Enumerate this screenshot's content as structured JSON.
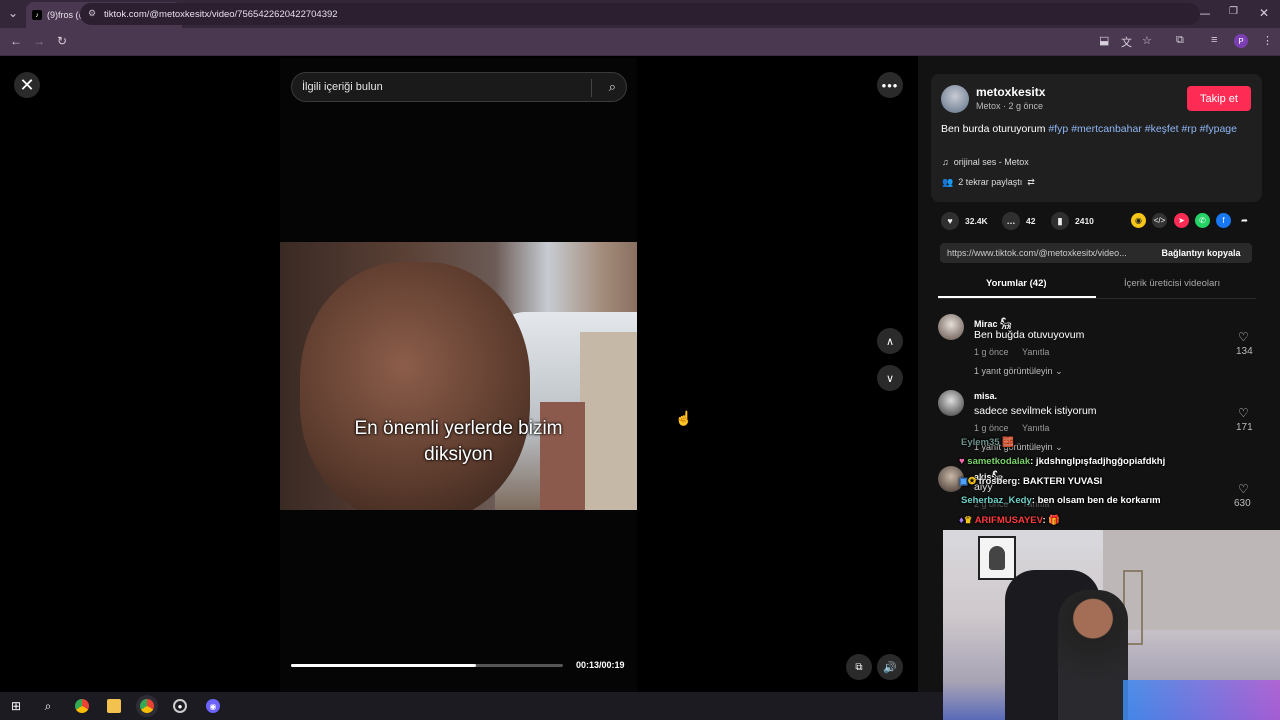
{
  "browser": {
    "tab_title": "(9)fros (@frosberg) | TikTok",
    "url": "tiktok.com/@metoxkesitx/video/7565422620422704392",
    "profile_initial": "P"
  },
  "video": {
    "search_placeholder": "İlgili içeriği bulun",
    "caption_line1": "En önemli yerlerde bizim",
    "caption_line2": "diksiyon",
    "time": "00:13/00:19",
    "progress": 0.68
  },
  "post": {
    "username": "metoxkesitx",
    "sub": "Metox · 2 g önce",
    "follow_label": "Takip et",
    "desc_text": "Ben burda oturuyorum",
    "hashtags": [
      "#fyp",
      "#mertcanbahar",
      "#keşfet",
      "#rp",
      "#fypage"
    ],
    "music": "orijinal ses - Metox",
    "reposts": "2 tekrar paylaştı",
    "likes": "32.4K",
    "comments": "42",
    "saves": "2410",
    "link": "https://www.tiktok.com/@metoxkesitx/video...",
    "copy_label": "Bağlantıyı kopyala"
  },
  "tabs": {
    "comments": "Yorumlar (42)",
    "creator": "İçerik üreticisi videoları"
  },
  "comments": [
    {
      "name": "Mirac 𓃵",
      "text": "Ben buğda otuvuyovum",
      "time": "1 g önce",
      "reply": "Yanıtla",
      "view_replies": "1 yanıt görüntüleyin",
      "likes": "134"
    },
    {
      "name": "misa.",
      "text": "sadece sevilmek istiyorum",
      "time": "1 g önce",
      "reply": "Yanıtla",
      "view_replies": "1 yanıt görüntüleyin",
      "likes": "171"
    },
    {
      "name": "akis𓃵",
      "text": "aiyy",
      "time": "2 g önce",
      "reply": "Yanıtla",
      "likes": "630"
    }
  ],
  "chat": [
    {
      "user": "Eylem35",
      "msg": ""
    },
    {
      "user": "sametkodalak",
      "msg": ": jkdshnglpışfadjhgğopiafdkhj"
    },
    {
      "user": "frosberg",
      "msg": ": BAKTERI YUVASI"
    },
    {
      "user": "Seherbaz_Kedy",
      "msg": ": ben olsam ben de korkarım"
    },
    {
      "user": "ARIFMUSAYEV",
      "msg": ":"
    }
  ],
  "colors": {
    "accent": "#fe2c55",
    "hashtag": "#8fb6f5",
    "panel": "#121212"
  }
}
